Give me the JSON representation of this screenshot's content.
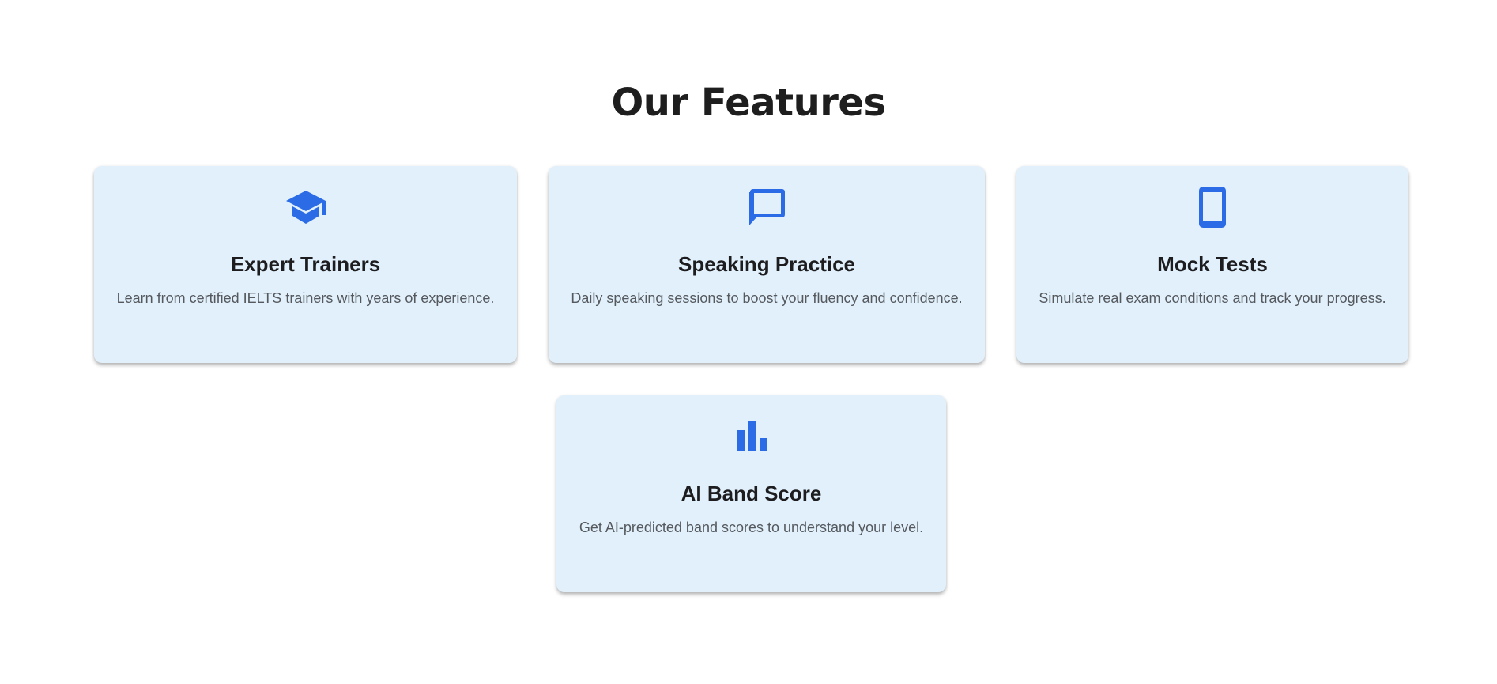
{
  "section": {
    "title": "Our Features"
  },
  "features": [
    {
      "icon": "graduation-cap-icon",
      "title": "Expert Trainers",
      "description": "Learn from certified IELTS trainers with years of experience."
    },
    {
      "icon": "chat-bubble-icon",
      "title": "Speaking Practice",
      "description": "Daily speaking sessions to boost your fluency and confidence."
    },
    {
      "icon": "smartphone-icon",
      "title": "Mock Tests",
      "description": "Simulate real exam conditions and track your progress."
    },
    {
      "icon": "bar-chart-icon",
      "title": "AI Band Score",
      "description": "Get AI-predicted band scores to understand your level."
    }
  ],
  "colors": {
    "accent": "#2b6be6",
    "card_background": "#e1f0fb",
    "title_text": "#1e1e1e",
    "description_text": "#55595e"
  }
}
